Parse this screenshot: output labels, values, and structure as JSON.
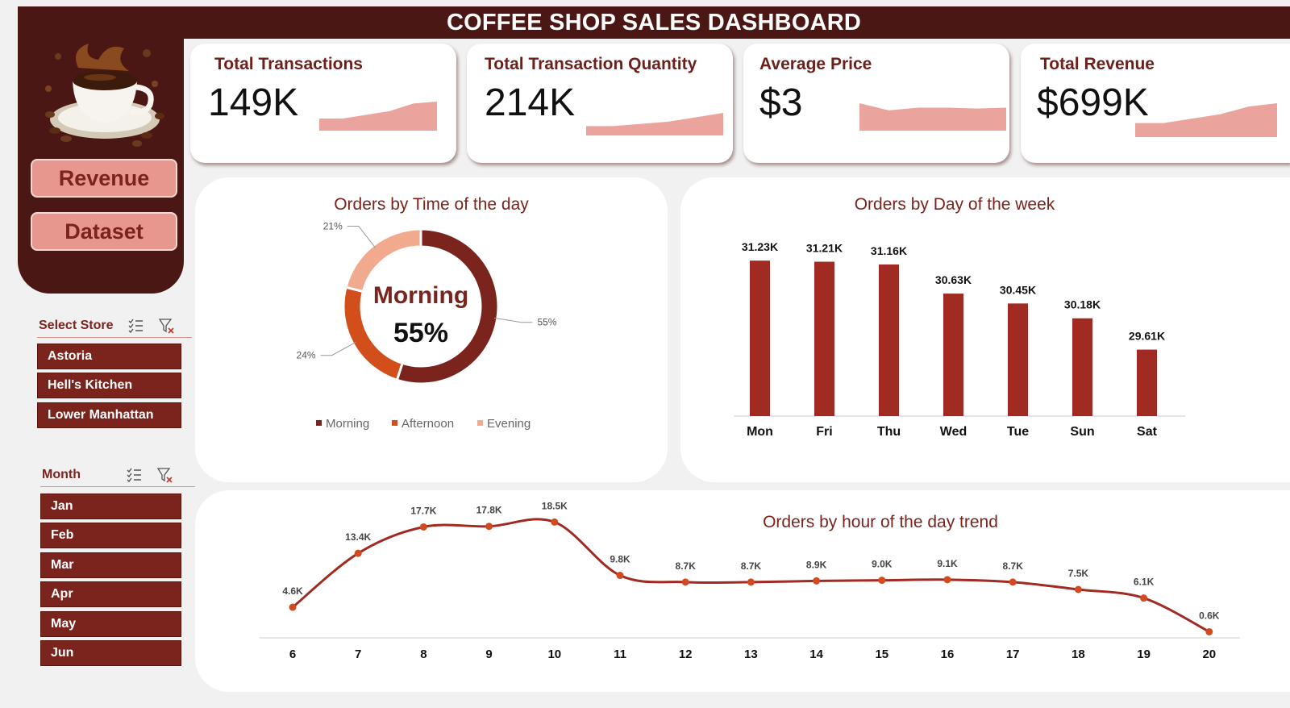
{
  "header": {
    "title": "COFFEE SHOP SALES DASHBOARD"
  },
  "nav": {
    "revenue_label": "Revenue",
    "dataset_label": "Dataset"
  },
  "slicers": {
    "store": {
      "title": "Select Store",
      "items": [
        "Astoria",
        "Hell's Kitchen",
        "Lower Manhattan"
      ]
    },
    "month": {
      "title": "Month",
      "items": [
        "Jan",
        "Feb",
        "Mar",
        "Apr",
        "May",
        "Jun"
      ]
    }
  },
  "kpis": [
    {
      "label": "Total Transactions",
      "value": "149K",
      "trend": [
        0.1,
        0.1,
        0.3,
        0.5,
        0.9,
        1.0
      ]
    },
    {
      "label": "Total Transaction Quantity",
      "value": "214K",
      "trend": [
        0.1,
        0.1,
        0.25,
        0.4,
        0.7,
        1.0
      ]
    },
    {
      "label": "Average Price",
      "value": "$3",
      "trend": [
        1.0,
        0.6,
        0.75,
        0.75,
        0.7,
        0.75
      ]
    },
    {
      "label": "Total Revenue",
      "value": "$699K",
      "trend": [
        0.1,
        0.1,
        0.3,
        0.5,
        0.85,
        1.0
      ]
    }
  ],
  "colors": {
    "brand_dark": "#4b1714",
    "bar": "#a12b22",
    "morning": "#7b231d",
    "afternoon": "#d24f1b",
    "evening": "#f2aa8f",
    "spark": "#eba39d"
  },
  "chart_data": [
    {
      "type": "pie",
      "title": "Orders by Time of the day",
      "center_label": "Morning",
      "center_value": "55%",
      "categories": [
        "Morning",
        "Afternoon",
        "Evening"
      ],
      "values": [
        55,
        24,
        21
      ],
      "labels": [
        "55%",
        "24%",
        "21%"
      ],
      "legend": "bottom"
    },
    {
      "type": "bar",
      "title": "Orders by Day of the week",
      "categories": [
        "Mon",
        "Fri",
        "Thu",
        "Wed",
        "Tue",
        "Sun",
        "Sat"
      ],
      "values": [
        31.23,
        31.21,
        31.16,
        30.63,
        30.45,
        30.18,
        29.61
      ],
      "labels": [
        "31.23K",
        "31.21K",
        "31.16K",
        "30.63K",
        "30.45K",
        "30.18K",
        "29.61K"
      ],
      "ylim": [
        28.4,
        31.6
      ]
    },
    {
      "type": "line",
      "title": "Orders by hour of the day trend",
      "x": [
        "6",
        "7",
        "8",
        "9",
        "10",
        "11",
        "12",
        "13",
        "14",
        "15",
        "16",
        "17",
        "18",
        "19",
        "20"
      ],
      "values": [
        4.6,
        13.4,
        17.7,
        17.8,
        18.5,
        9.8,
        8.7,
        8.7,
        8.9,
        9.0,
        9.1,
        8.7,
        7.5,
        6.1,
        0.6
      ],
      "labels": [
        "4.6K",
        "13.4K",
        "17.7K",
        "17.8K",
        "18.5K",
        "9.8K",
        "8.7K",
        "8.7K",
        "8.9K",
        "9.0K",
        "9.1K",
        "8.7K",
        "7.5K",
        "6.1K",
        "0.6K"
      ],
      "ylim": [
        0,
        20
      ]
    }
  ]
}
